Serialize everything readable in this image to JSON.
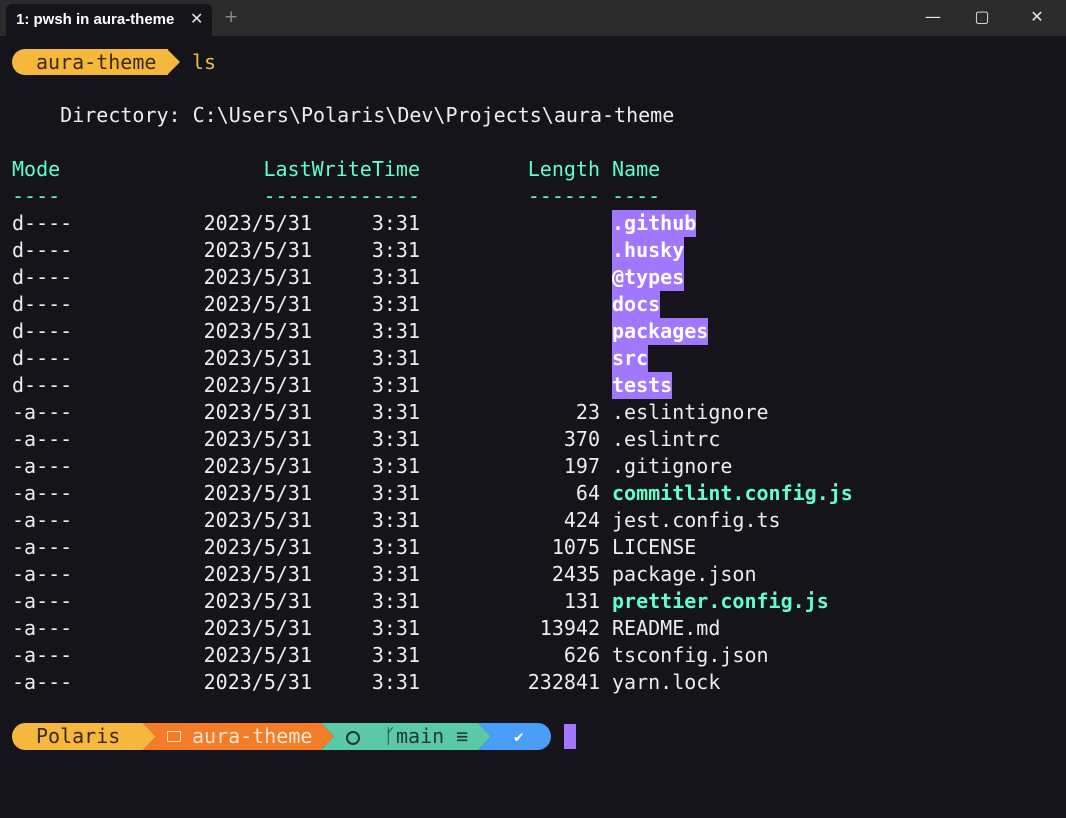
{
  "tab": {
    "title": "1: pwsh in aura-theme",
    "close_icon": "close-icon",
    "new_tab_icon": "plus-icon"
  },
  "window": {
    "minimize_icon": "minimize-icon",
    "maximize_icon": "maximize-icon",
    "close_icon": "close-icon"
  },
  "prompt1": {
    "folder": "aura-theme",
    "command": "ls"
  },
  "directory_line": "    Directory: C:\\Users\\Polaris\\Dev\\Projects\\aura-theme",
  "table": {
    "headers": {
      "mode": "Mode",
      "time": "LastWriteTime",
      "length": "Length",
      "name": "Name"
    },
    "underlines": {
      "mode": "----",
      "time": "-------------",
      "length": "------",
      "name": "----"
    },
    "rows": [
      {
        "mode": "d----",
        "date": "2023/5/31",
        "time": "3:31",
        "length": "",
        "name": ".github",
        "kind": "dir"
      },
      {
        "mode": "d----",
        "date": "2023/5/31",
        "time": "3:31",
        "length": "",
        "name": ".husky",
        "kind": "dir"
      },
      {
        "mode": "d----",
        "date": "2023/5/31",
        "time": "3:31",
        "length": "",
        "name": "@types",
        "kind": "dir"
      },
      {
        "mode": "d----",
        "date": "2023/5/31",
        "time": "3:31",
        "length": "",
        "name": "docs",
        "kind": "dir"
      },
      {
        "mode": "d----",
        "date": "2023/5/31",
        "time": "3:31",
        "length": "",
        "name": "packages",
        "kind": "dir"
      },
      {
        "mode": "d----",
        "date": "2023/5/31",
        "time": "3:31",
        "length": "",
        "name": "src",
        "kind": "dir"
      },
      {
        "mode": "d----",
        "date": "2023/5/31",
        "time": "3:31",
        "length": "",
        "name": "tests",
        "kind": "dir"
      },
      {
        "mode": "-a---",
        "date": "2023/5/31",
        "time": "3:31",
        "length": "23",
        "name": ".eslintignore",
        "kind": "file"
      },
      {
        "mode": "-a---",
        "date": "2023/5/31",
        "time": "3:31",
        "length": "370",
        "name": ".eslintrc",
        "kind": "file"
      },
      {
        "mode": "-a---",
        "date": "2023/5/31",
        "time": "3:31",
        "length": "197",
        "name": ".gitignore",
        "kind": "file"
      },
      {
        "mode": "-a---",
        "date": "2023/5/31",
        "time": "3:31",
        "length": "64",
        "name": "commitlint.config.js",
        "kind": "js"
      },
      {
        "mode": "-a---",
        "date": "2023/5/31",
        "time": "3:31",
        "length": "424",
        "name": "jest.config.ts",
        "kind": "file"
      },
      {
        "mode": "-a---",
        "date": "2023/5/31",
        "time": "3:31",
        "length": "1075",
        "name": "LICENSE",
        "kind": "file"
      },
      {
        "mode": "-a---",
        "date": "2023/5/31",
        "time": "3:31",
        "length": "2435",
        "name": "package.json",
        "kind": "file"
      },
      {
        "mode": "-a---",
        "date": "2023/5/31",
        "time": "3:31",
        "length": "131",
        "name": "prettier.config.js",
        "kind": "js"
      },
      {
        "mode": "-a---",
        "date": "2023/5/31",
        "time": "3:31",
        "length": "13942",
        "name": "README.md",
        "kind": "file"
      },
      {
        "mode": "-a---",
        "date": "2023/5/31",
        "time": "3:31",
        "length": "626",
        "name": "tsconfig.json",
        "kind": "file"
      },
      {
        "mode": "-a---",
        "date": "2023/5/31",
        "time": "3:31",
        "length": "232841",
        "name": "yarn.lock",
        "kind": "file"
      }
    ]
  },
  "prompt2": {
    "user": "Polaris",
    "folder_icon": "folder-icon",
    "folder": "aura-theme",
    "github_icon": "github-icon",
    "branch_icon": "git-branch-icon",
    "branch": "main",
    "sync_icon": "equals-icon",
    "status_icon": "check-icon"
  },
  "colors": {
    "background": "#15141b",
    "titlebar": "#2b2b2b",
    "yellow": "#ffca85",
    "orange": "#f47b28",
    "green": "#61ffca",
    "teal": "#5bc9a7",
    "blue": "#4a9df8",
    "purple": "#a277ff",
    "text": "#edecee"
  }
}
